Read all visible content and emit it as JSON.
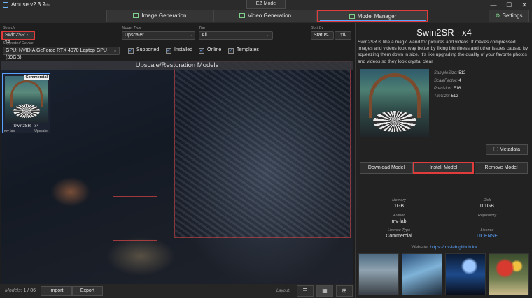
{
  "window": {
    "title": "Amuse v2.3.2",
    "beta": "beta",
    "ez_mode": "EZ Mode",
    "minimize": "—",
    "maximize": "☐",
    "close": "✕"
  },
  "tabs": [
    {
      "label": "Image Generation"
    },
    {
      "label": "Video Generation"
    },
    {
      "label": "Model Manager"
    }
  ],
  "settings_label": "Settings",
  "filters": {
    "search_label": "Search",
    "search_value": "Swin2SR - x4",
    "model_type_label": "Model Type",
    "model_type_value": "Upscaler",
    "tag_label": "Tag",
    "tag_value": "All",
    "sort_label": "Sort By",
    "sort_value": "Status",
    "sort_dir": "↑⇅",
    "device_label": "Supported Device",
    "device_value": "GPU: NVIDIA GeForce RTX 4070 Laptop GPU (39GB)",
    "checks": [
      {
        "label": "Supported",
        "checked": true
      },
      {
        "label": "Installed",
        "checked": true
      },
      {
        "label": "Online",
        "checked": true
      },
      {
        "label": "Templates",
        "checked": true
      }
    ]
  },
  "gallery": {
    "header": "Upscale/Restoration Models",
    "card": {
      "badge": "Commercial",
      "name": "Swin2SR - x4",
      "author": "mv-lab",
      "type": "Upscaler"
    }
  },
  "bottombar": {
    "models_label": "Models:",
    "models_count": "1 / 86",
    "import_label": "Import",
    "export_label": "Export",
    "layout_label": "Layout:"
  },
  "detail": {
    "title": "Swin2SR - x4",
    "description": "Swin2SR is like a magic wand for pictures and videos. It makes compressed images and videos look way better by fixing blurriness and other issues caused by squeezing them down in size. It's like upgrading the quality of your favorite photos and videos so they look crystal clear",
    "props": [
      {
        "label": "SampleSize:",
        "value": "512"
      },
      {
        "label": "ScaleFactor:",
        "value": "4"
      },
      {
        "label": "Precision:",
        "value": "F16"
      },
      {
        "label": "TileSize:",
        "value": "512"
      }
    ],
    "metadata_label": "Metadata",
    "download_label": "Download Model",
    "install_label": "Install Model",
    "remove_label": "Remove Model",
    "memory_label": "Memory",
    "memory_value": "1GB",
    "disk_label": "Disk",
    "disk_value": "0.1GB",
    "author_label": "Author",
    "author_value": "mv-lab",
    "repository_label": "Repository",
    "licence_type_label": "Licence Type",
    "licence_type_value": "Commercial",
    "licence_label": "Licence",
    "licence_value": "LICENSE",
    "website_label": "Website:",
    "website_value": "https://mv-lab.github.io/"
  },
  "colors": {
    "accent": "#5aa2ff",
    "highlight": "#e03c3c",
    "icon_green": "#7fd18b"
  },
  "icons": [
    "app-icon",
    "image-icon",
    "video-icon",
    "layers-icon",
    "gear-icon",
    "info-icon",
    "list-layout-icon",
    "grid-layout-icon",
    "tile-layout-icon"
  ]
}
